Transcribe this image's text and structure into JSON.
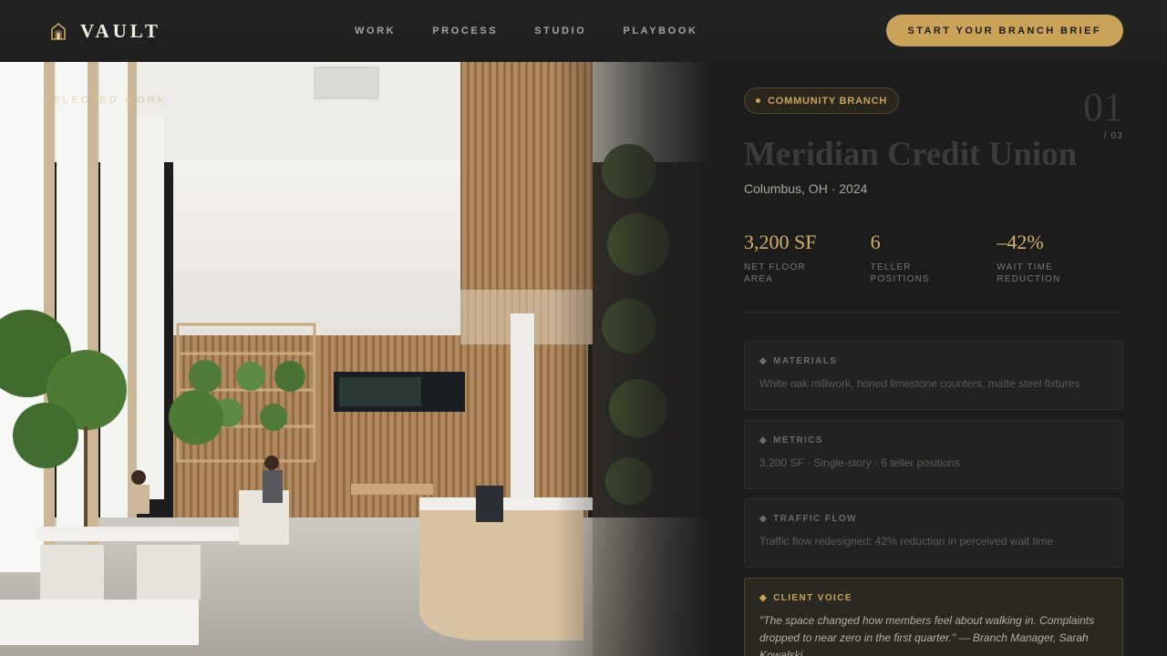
{
  "nav": {
    "brand": "VAULT",
    "links": [
      "WORK",
      "PROCESS",
      "STUDIO",
      "PLAYBOOK"
    ],
    "cta": "START YOUR BRANCH BRIEF"
  },
  "hero": {
    "overlay_label": "SELECTED WORK"
  },
  "project": {
    "tag": "COMMUNITY BRANCH",
    "index": "01",
    "index_total": "/ 03",
    "title": "Meridian Credit Union",
    "location": "Columbus, OH · 2024",
    "stats": [
      {
        "value": "3,200 SF",
        "label": "NET FLOOR AREA"
      },
      {
        "value": "6",
        "label": "TELLER POSITIONS"
      },
      {
        "value": "–42%",
        "label": "WAIT TIME REDUCTION"
      }
    ],
    "cards": [
      {
        "head": "MATERIALS",
        "body": "White oak millwork, honed limestone counters, matte steel fixtures"
      },
      {
        "head": "METRICS",
        "body": "3,200 SF · Single-story · 6 teller positions"
      },
      {
        "head": "TRAFFIC FLOW",
        "body": "Traffic flow redesigned: 42% reduction in perceived wait time"
      },
      {
        "head": "CLIENT VOICE",
        "body": "\"The space changed how members feel about walking in. Complaints dropped to near zero in the first quarter.\" — Branch Manager, Sarah Kowalski"
      }
    ],
    "card_glyph": "◆"
  },
  "colors": {
    "accent": "#c9a458",
    "background": "#1c1c1c"
  }
}
